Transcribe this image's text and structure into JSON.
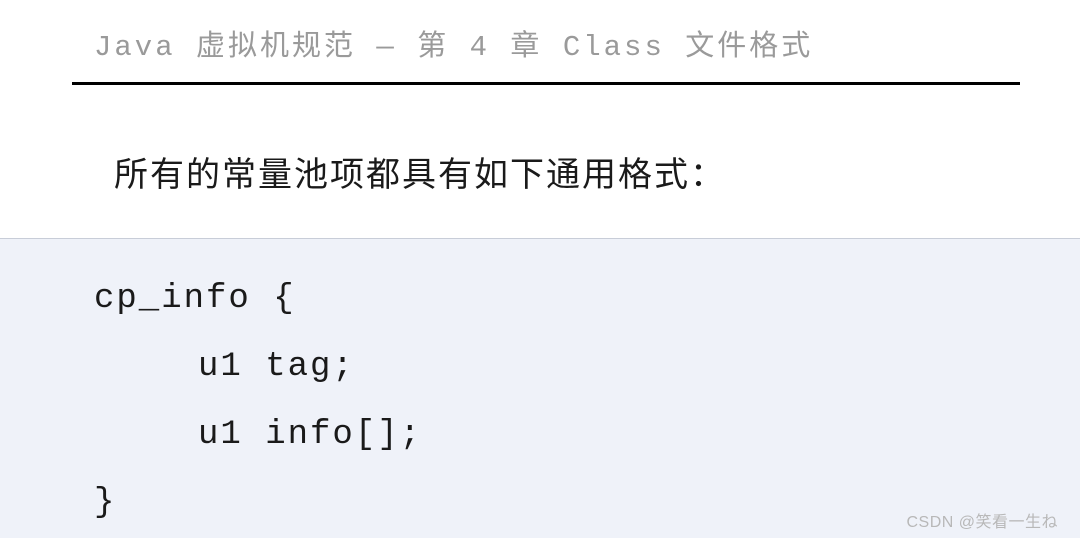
{
  "header": {
    "title": "Java 虚拟机规范 — 第 4 章 Class 文件格式"
  },
  "description": "所有的常量池项都具有如下通用格式：",
  "code": {
    "line1": "cp_info {",
    "line2": "u1 tag;",
    "line3": "u1 info[];",
    "line4": "}"
  },
  "watermark": "CSDN @笑看一生ね"
}
